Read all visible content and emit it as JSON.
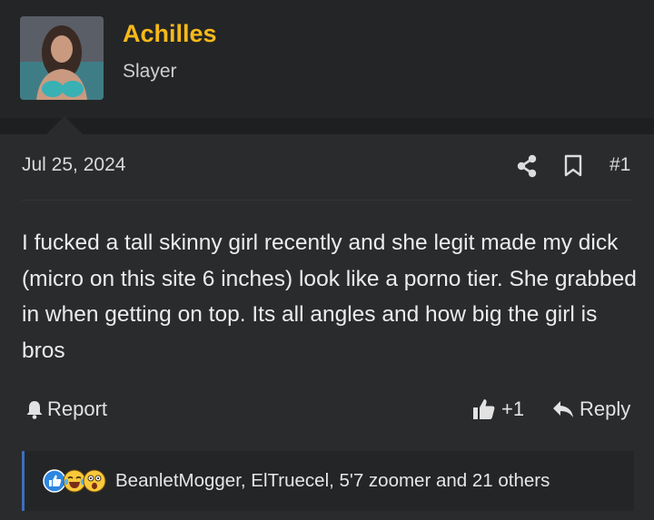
{
  "user": {
    "name": "Achilles",
    "title": "Slayer"
  },
  "post": {
    "date": "Jul 25, 2024",
    "number": "#1",
    "text": "I fucked a tall skinny girl recently and she legit made my dick (micro on this site 6 inches) look like a porno tier. She grabbed in when getting on top. Its all angles and how big the girl is bros"
  },
  "actions": {
    "report_label": "Report",
    "like_count": "+1",
    "reply_label": "Reply"
  },
  "reactions": {
    "icons": [
      "like-icon",
      "laughing-crying-icon",
      "shocked-face-icon"
    ],
    "summary": "BeanletMogger, ElTruecel, 5'7 zoomer and 21 others"
  },
  "colors": {
    "username": "#f6b91a",
    "background": "#1e1f21",
    "message_bg": "#2a2b2d",
    "reaction_accent": "#3d6fb8"
  }
}
